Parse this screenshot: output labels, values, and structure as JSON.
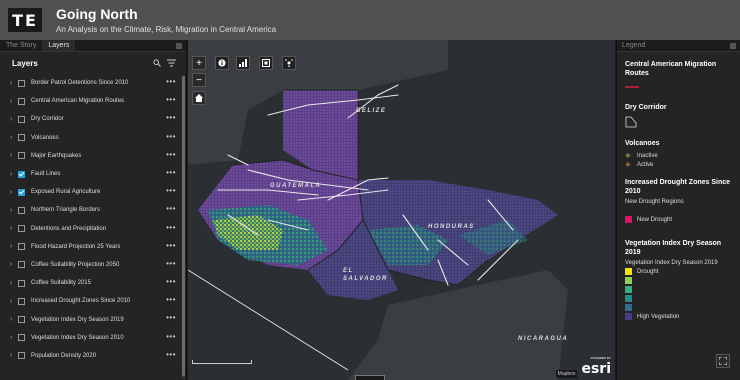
{
  "header": {
    "logo": "TE",
    "title": "Going North",
    "subtitle": "An Analysis on the Climate, Risk, Migration in Central America"
  },
  "left_panel": {
    "tabs": [
      "The Story",
      "Layers"
    ],
    "heading": "Layers",
    "layers": [
      {
        "label": "Border Patrol Detentions Since 2010",
        "checked": false
      },
      {
        "label": "Central American Migration Routes",
        "checked": false
      },
      {
        "label": "Dry Corridor",
        "checked": false
      },
      {
        "label": "Volcanoes",
        "checked": false
      },
      {
        "label": "Major Earthquakes",
        "checked": false
      },
      {
        "label": "Fault Lines",
        "checked": true
      },
      {
        "label": "Exposed Rural Agriculture",
        "checked": true
      },
      {
        "label": "Northern Triangle Borders",
        "checked": false
      },
      {
        "label": "Detentions and Precipitation",
        "checked": false
      },
      {
        "label": "Flood Hazard Projection 25 Years",
        "checked": false
      },
      {
        "label": "Coffee Suitability Projection 2050",
        "checked": false
      },
      {
        "label": "Coffee Suitability 2015",
        "checked": false
      },
      {
        "label": "Increased Drought Zones Since 2010",
        "checked": false
      },
      {
        "label": "Vegetation Index Dry Season 2019",
        "checked": false
      },
      {
        "label": "Vegetation Index Dry Season 2010",
        "checked": false
      },
      {
        "label": "Population Density 2020",
        "checked": false
      }
    ],
    "more_label": "•••"
  },
  "map": {
    "zoom_in": "+",
    "zoom_out": "−",
    "labels": {
      "belize": "BELIZE",
      "guatemala": "GUATEMALA",
      "honduras": "HONDURAS",
      "el_salvador_1": "EL",
      "el_salvador_2": "SALVADOR",
      "nicaragua": "NICARAGUA"
    },
    "mapbox": "Mapbox",
    "esri": "esri",
    "esri_powered": "POWERED BY"
  },
  "legend": {
    "tab": "Legend",
    "migration_title": "Central American Migration Routes",
    "dry_corridor_title": "Dry Corridor",
    "volcanoes_title": "Volcanoes",
    "volcano_items": [
      "Inactive",
      "Active"
    ],
    "drought_title": "Increased Drought Zones Since 2010",
    "drought_sub": "New Drought Regions",
    "drought_item": "New Drought",
    "veg_title": "Vegetation Index Dry Season 2019",
    "veg_sub": "Vegetation Index Dry Season 2019",
    "veg_items": [
      {
        "label": "Drought",
        "color": "#f2e600"
      },
      {
        "label": "",
        "color": "#8fd14f"
      },
      {
        "label": "",
        "color": "#2fb47c"
      },
      {
        "label": "",
        "color": "#1f8f8a"
      },
      {
        "label": "",
        "color": "#2a6f8e"
      },
      {
        "label": "High Vegetation",
        "color": "#4a3c8c"
      }
    ],
    "colors": {
      "migration": "#d21f3c",
      "drought": "#e0106c",
      "accent": "#2d9fd8"
    }
  }
}
